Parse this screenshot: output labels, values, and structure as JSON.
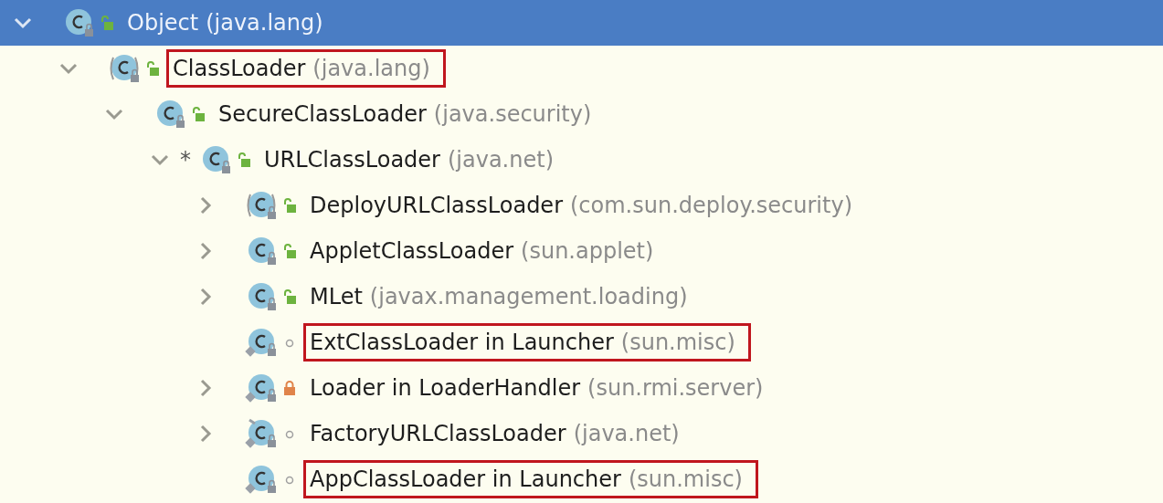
{
  "tree": [
    {
      "name": "Object",
      "package": "(java.lang)",
      "expanded": true,
      "selected": true,
      "highlighted": false,
      "kind": "class_public",
      "children": [
        {
          "name": "ClassLoader",
          "package": "(java.lang)",
          "expanded": true,
          "selected": false,
          "highlighted": true,
          "kind": "abstract_public",
          "children": [
            {
              "name": "SecureClassLoader",
              "package": "(java.security)",
              "expanded": true,
              "selected": false,
              "highlighted": false,
              "kind": "class_public",
              "children": [
                {
                  "name": "URLClassLoader",
                  "package": "(java.net)",
                  "marker": "*",
                  "expanded": true,
                  "selected": false,
                  "highlighted": false,
                  "kind": "class_public",
                  "children": [
                    {
                      "name": "DeployURLClassLoader",
                      "package": "(com.sun.deploy.security)",
                      "expanded": false,
                      "selected": false,
                      "highlighted": false,
                      "kind": "abstract_public"
                    },
                    {
                      "name": "AppletClassLoader",
                      "package": "(sun.applet)",
                      "expanded": false,
                      "selected": false,
                      "highlighted": false,
                      "kind": "class_public"
                    },
                    {
                      "name": "MLet",
                      "package": "(javax.management.loading)",
                      "expanded": false,
                      "selected": false,
                      "highlighted": false,
                      "kind": "class_public"
                    },
                    {
                      "name": "ExtClassLoader in Launcher",
                      "package": "(sun.misc)",
                      "selected": false,
                      "highlighted": true,
                      "kind": "inner_package"
                    },
                    {
                      "name": "Loader in LoaderHandler",
                      "package": "(sun.rmi.server)",
                      "expanded": false,
                      "selected": false,
                      "highlighted": false,
                      "kind": "inner_private"
                    },
                    {
                      "name": "FactoryURLClassLoader",
                      "package": "(java.net)",
                      "expanded": false,
                      "selected": false,
                      "highlighted": false,
                      "kind": "anonymous_package"
                    },
                    {
                      "name": "AppClassLoader in Launcher",
                      "package": "(sun.misc)",
                      "selected": false,
                      "highlighted": true,
                      "kind": "inner_package"
                    }
                  ]
                }
              ]
            }
          ]
        }
      ]
    }
  ]
}
